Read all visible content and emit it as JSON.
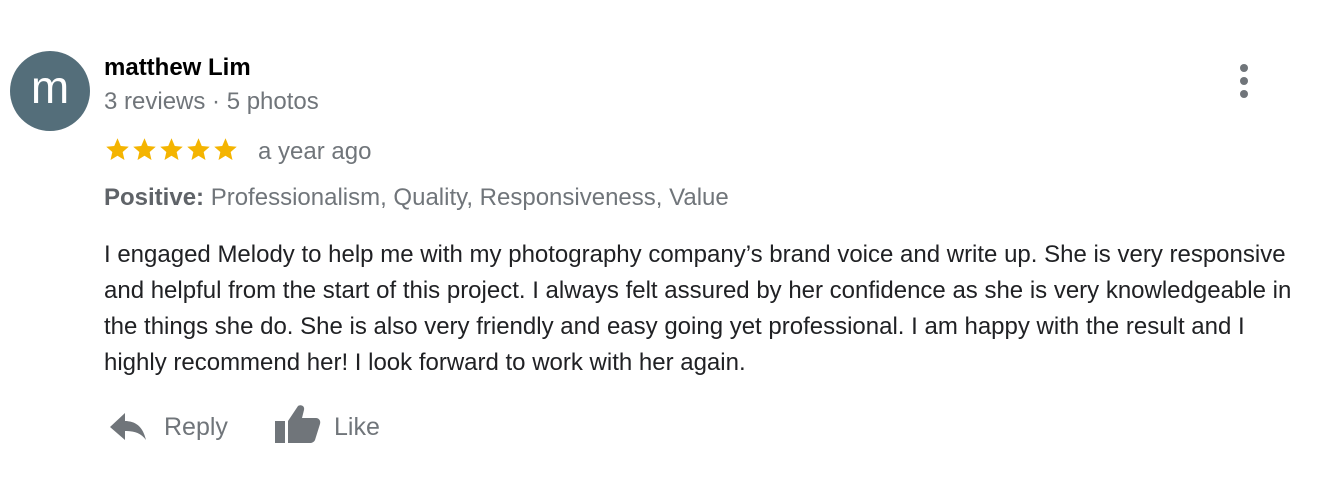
{
  "reviewer": {
    "initial": "m",
    "name": "matthew Lim",
    "meta": "3 reviews · 5 photos"
  },
  "rating": {
    "stars": 5,
    "max": 5,
    "time_ago": "a year ago"
  },
  "attributes": {
    "label": "Positive:",
    "values": "Professionalism, Quality, Responsiveness, Value"
  },
  "review_text": "I engaged Melody to help me with my photography company’s brand voice and write up. She is very responsive and helpful from the start of this project. I always felt assured by her confidence as she is very knowledgeable in the things she do. She is also very friendly and easy going yet professional. I am happy with the result and I highly recommend her! I look forward to work with her again.",
  "actions": {
    "reply_label": "Reply",
    "like_label": "Like"
  },
  "icons": {
    "more": "more-vert-icon",
    "reply": "reply-arrow-icon",
    "like": "thumbs-up-icon",
    "star": "star-icon"
  },
  "colors": {
    "avatar_bg": "#546e7a",
    "star": "#f4b400",
    "secondary_text": "#70757a",
    "icon": "#70757a"
  }
}
